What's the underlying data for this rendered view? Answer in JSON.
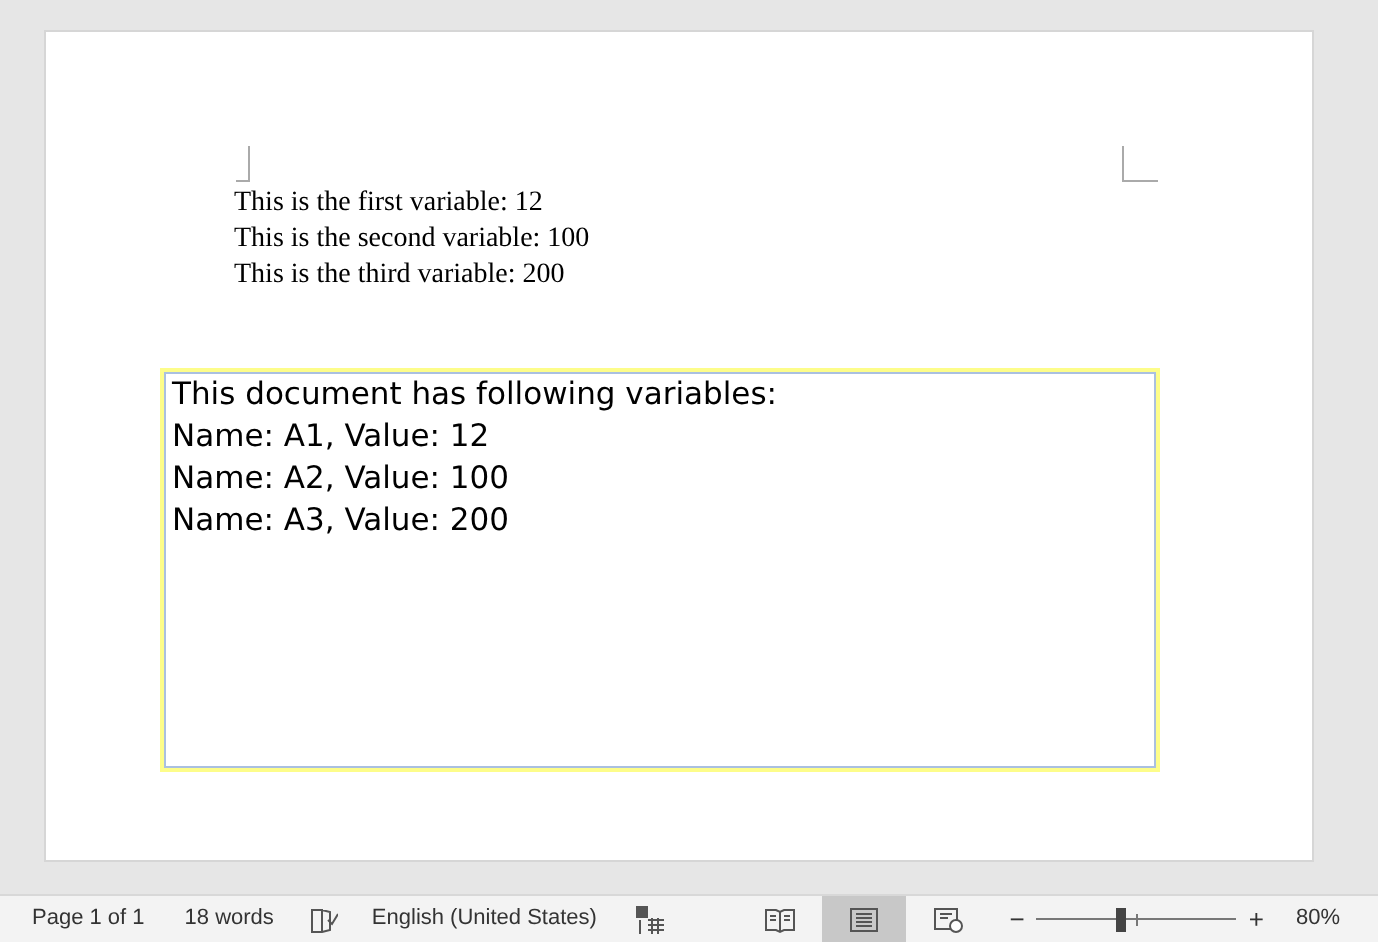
{
  "document": {
    "paragraphs": [
      "This is the first variable: 12",
      "This is the second variable: 100",
      "This is the third variable: 200"
    ],
    "text_box": [
      "This document has following variables:",
      "Name: A1, Value: 12",
      "Name: A2, Value: 100",
      "Name: A3, Value: 200"
    ]
  },
  "status_bar": {
    "page": "Page 1 of 1",
    "words": "18 words",
    "language": "English (United States)",
    "views": [
      {
        "kind": "read",
        "selected": false
      },
      {
        "kind": "print",
        "selected": true
      },
      {
        "kind": "web",
        "selected": false
      }
    ],
    "zoom": {
      "minus": "−",
      "plus": "+",
      "level": 0.42,
      "percent": "80%"
    }
  }
}
